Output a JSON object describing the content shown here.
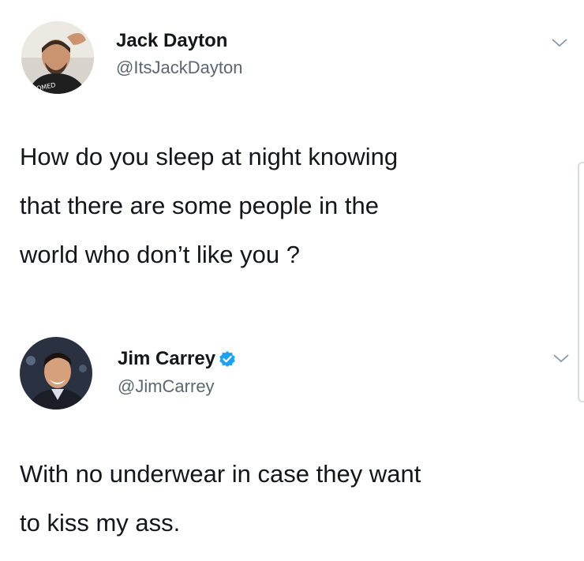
{
  "tweets": [
    {
      "author": {
        "name": "Jack Dayton",
        "handle": "@ItsJackDayton",
        "verified": false,
        "avatar_icon": "person-avatar"
      },
      "text_lines": [
        "How do you sleep at night knowing",
        "that there are some people in the",
        "world who don’t like you ?"
      ]
    },
    {
      "author": {
        "name": "Jim Carrey",
        "handle": "@JimCarrey",
        "verified": true,
        "avatar_icon": "person-avatar"
      },
      "text_lines": [
        "With no underwear in case they want",
        "to kiss my ass."
      ]
    }
  ],
  "icons": {
    "menu": "chevron-down-icon",
    "verified": "verified-badge-icon"
  },
  "colors": {
    "text": "#14171a",
    "handle": "#5b6670",
    "verified": "#1da1f2",
    "chevron": "#8899a6"
  }
}
